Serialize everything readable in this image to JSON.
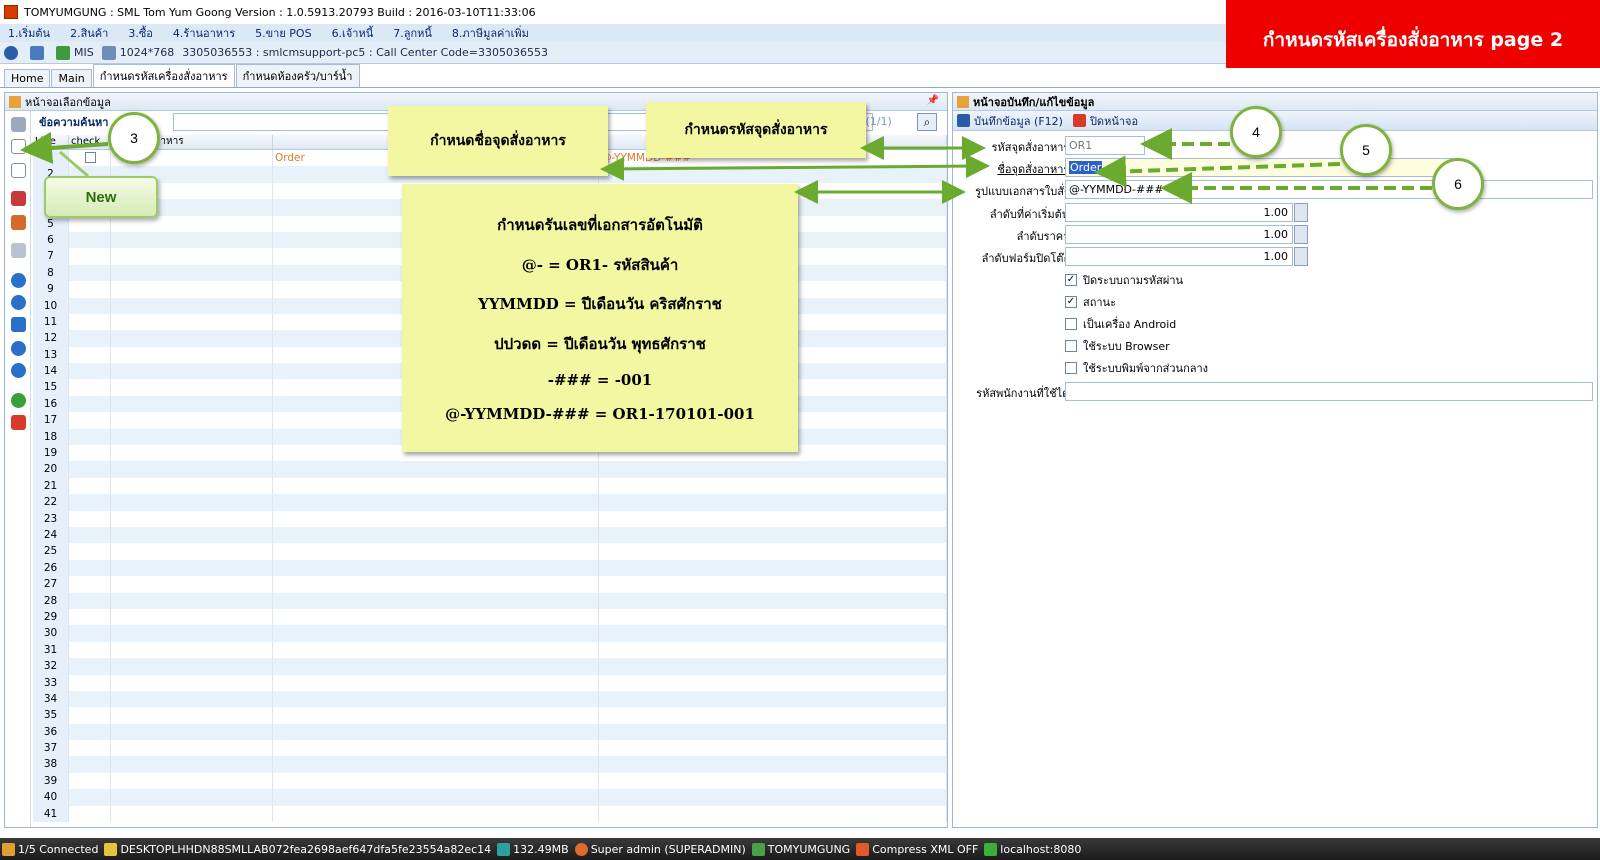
{
  "window": {
    "title": "TOMYUMGUNG : SML Tom Yum Goong Version : 1.0.5913.20793  Build : 2016-03-10T11:33:06"
  },
  "banner": "กำหนดรหัสเครื่องสั่งอาหาร page 2",
  "menu": [
    "1.เริ่มต้น",
    "2.สินค้า",
    "3.ซื้อ",
    "4.ร้านอาหาร",
    "5.ขาย POS",
    "6.เจ้าหนี้",
    "7.ลูกหนี้",
    "8.ภาษีมูลค่าเพิ่ม"
  ],
  "infobar": {
    "mis": "MIS",
    "resolution": "1024*768",
    "session": "3305036553 : smlcmsupport-pc5 : Call Center Code=3305036553"
  },
  "tabs": [
    "Home",
    "Main",
    "กำหนดรหัสเครื่องสั่งอาหาร",
    "กำหนดห้องครัว/บาร์น้ำ"
  ],
  "left": {
    "header": "หน้าจอเลือกข้อมูล",
    "search_label": "ข้อความค้นหา",
    "page_info": "1 (1/1)",
    "columns": [
      "Line",
      "check",
      "รหัสจุดสั่งอาหาร",
      "",
      ""
    ],
    "rows": [
      {
        "line": "1",
        "code": "",
        "name": "Order",
        "format": "@-YYMMDD-###"
      },
      {
        "line": "2"
      },
      {
        "line": "3"
      },
      {
        "line": "4"
      },
      {
        "line": "5"
      },
      {
        "line": "6"
      },
      {
        "line": "7"
      },
      {
        "line": "8"
      },
      {
        "line": "9"
      },
      {
        "line": "10"
      },
      {
        "line": "11"
      },
      {
        "line": "12"
      },
      {
        "line": "13"
      },
      {
        "line": "14"
      },
      {
        "line": "15"
      },
      {
        "line": "16"
      },
      {
        "line": "17"
      },
      {
        "line": "18"
      },
      {
        "line": "19"
      },
      {
        "line": "20"
      },
      {
        "line": "21"
      },
      {
        "line": "22"
      },
      {
        "line": "23"
      },
      {
        "line": "24"
      },
      {
        "line": "25"
      },
      {
        "line": "26"
      },
      {
        "line": "27"
      },
      {
        "line": "28"
      },
      {
        "line": "29"
      },
      {
        "line": "30"
      },
      {
        "line": "31"
      },
      {
        "line": "32"
      },
      {
        "line": "33"
      },
      {
        "line": "34"
      },
      {
        "line": "35"
      },
      {
        "line": "36"
      },
      {
        "line": "37"
      },
      {
        "line": "38"
      },
      {
        "line": "39"
      },
      {
        "line": "40"
      },
      {
        "line": "41"
      }
    ]
  },
  "right": {
    "header": "หน้าจอบันทึก/แก้ไขข้อมูล",
    "save_label": "บันทึกข้อมูล (F12)",
    "close_label": "ปิดหน้าจอ",
    "fields": {
      "code_label": "รหัสจุดสั่งอาหาร:",
      "code_value": "OR1",
      "name_label": "ชื่อจุดสั่งอาหาร:",
      "name_value": "Order",
      "format_label": "รูปแบบเอกสารใบสั่ง:",
      "format_value": "@-YYMMDD-###",
      "start_label": "ลำดับที่ค่าเริ่มต้น:",
      "start_value": "1.00",
      "price_label": "ลำดับราคา:",
      "price_value": "1.00",
      "form_label": "ลำดับฟอร์มปิดโต๊ะ:",
      "form_value": "1.00",
      "staff_label": "รหัสพนักงานที่ใช้ได้:",
      "staff_value": ""
    },
    "checkboxes": [
      {
        "label": "ปิดระบบถามรหัสผ่าน",
        "checked": true
      },
      {
        "label": "สถานะ",
        "checked": true
      },
      {
        "label": "เป็นเครื่อง Android",
        "checked": false
      },
      {
        "label": "ใช้ระบบ Browser",
        "checked": false
      },
      {
        "label": "ใช้ระบบพิมพ์จากส่วนกลาง",
        "checked": false
      }
    ]
  },
  "statusbar": {
    "connected": "1/5 Connected",
    "machine": "DESKTOPLHHDN88SMLLAB072fea2698aef647dfa5fe23554a82ec14",
    "memory": "132.49MB",
    "user": "Super admin (SUPERADMIN)",
    "db": "TOMYUMGUNG",
    "compress": "Compress XML OFF",
    "server": "localhost:8080"
  },
  "annotations": {
    "circle3": "3",
    "circle4": "4",
    "circle5": "5",
    "circle6": "6",
    "new_callout": "New",
    "note_name": "กำหนดชื่อจุดสั่งอาหาร",
    "note_code": "กำหนดรหัสจุดสั่งอาหาร",
    "note_lines": [
      "กำหนดรันเลขที่เอกสารอัตโนมัติ",
      "@- = OR1- รหัสสินค้า",
      "YYMMDD = ปีเดือนวัน คริสศักราช",
      "ปปวดด = ปีเดือนวัน พุทธศักราช",
      "-###  =  -001",
      "@-YYMMDD-### = OR1-170101-001"
    ]
  },
  "colors": {
    "banner": "#ee0000",
    "annotation_green": "#6aaa2e",
    "note_yellow": "#f4f7a2"
  }
}
